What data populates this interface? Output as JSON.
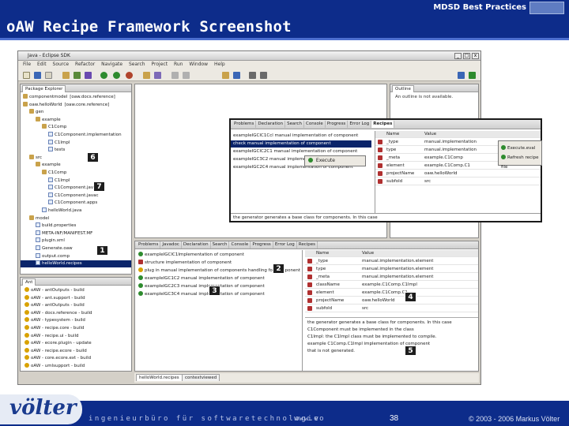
{
  "slide": {
    "subtitle": "MDSD Best Practices",
    "title": "oAW Recipe Framework Screenshot",
    "footer_tagline": "ingenieurbüro für softwaretechnologie",
    "footer_url": "www.vo",
    "page_number": "38",
    "copyright": "© 2003 - 2006 Markus Völter",
    "logo": "völter"
  },
  "ide": {
    "window_title": "Java - Eclipse SDK",
    "window_buttons": [
      "_",
      "□",
      "x"
    ],
    "menu": [
      "File",
      "Edit",
      "Source",
      "Refactor",
      "Navigate",
      "Search",
      "Project",
      "Run",
      "Window",
      "Help"
    ],
    "explorer": {
      "tab_label": "Package Explorer",
      "rows": [
        {
          "text": "componentmodel",
          "suffix": "[oaw.docs.reference]",
          "icon": "pkg",
          "depth": 0
        },
        {
          "text": "oaw.helloWorld",
          "suffix": "[oaw.core.reference]",
          "icon": "pkg",
          "depth": 0
        },
        {
          "text": "gen",
          "suffix": "",
          "icon": "pkg",
          "depth": 1
        },
        {
          "text": "example",
          "suffix": "",
          "icon": "pkg",
          "depth": 2
        },
        {
          "text": "C1Comp",
          "suffix": "",
          "icon": "pkg",
          "depth": 3
        },
        {
          "text": "C1Component.implementation",
          "suffix": "",
          "icon": "file",
          "depth": 4
        },
        {
          "text": "C1Impl",
          "suffix": "",
          "icon": "file",
          "depth": 4
        },
        {
          "text": "tests",
          "suffix": "",
          "icon": "file",
          "depth": 4
        },
        {
          "text": "src",
          "suffix": "",
          "icon": "pkg",
          "depth": 1
        },
        {
          "text": "example",
          "suffix": "",
          "icon": "pkg",
          "depth": 2
        },
        {
          "text": "C1Comp",
          "suffix": "",
          "icon": "pkg",
          "depth": 3
        },
        {
          "text": "C1Impl",
          "suffix": "",
          "icon": "file",
          "depth": 4
        },
        {
          "text": "C1Component.java",
          "suffix": "",
          "icon": "file",
          "depth": 4
        },
        {
          "text": "C1Component.javac",
          "suffix": "",
          "icon": "file",
          "depth": 4
        },
        {
          "text": "C1Component.apps",
          "suffix": "",
          "icon": "file",
          "depth": 4
        },
        {
          "text": "helloWorld.java",
          "suffix": "",
          "icon": "file",
          "depth": 3
        },
        {
          "text": "model",
          "suffix": "",
          "icon": "pkg",
          "depth": 1
        },
        {
          "text": "build.properties",
          "suffix": "",
          "icon": "file",
          "depth": 2
        },
        {
          "text": "META-INF/MANIFEST.MF",
          "suffix": "",
          "icon": "file",
          "depth": 2
        },
        {
          "text": "plugin.xml",
          "suffix": "",
          "icon": "file",
          "depth": 2
        },
        {
          "text": "Generate.oaw",
          "suffix": "",
          "icon": "file",
          "depth": 2
        },
        {
          "text": "output.comp",
          "suffix": "",
          "icon": "file",
          "depth": 2
        },
        {
          "text": "helloWorld.recipes",
          "suffix": "",
          "icon": "file",
          "depth": 2,
          "selected": true
        }
      ]
    },
    "ant": {
      "tab_label": "Ant",
      "rows": [
        "oAW - antOutputs - build",
        "oAW - ant.support - build",
        "oAW - antOutputs - build",
        "oAW - docs.reference - build",
        "oAW - typesystem - build",
        "oAW - recipe.core - build",
        "oAW - recipe.ui - build",
        "oAW - ecore.plugin - update",
        "oAW - recipe.ecore - build",
        "oAW - core.ecore.ext - build",
        "oAW - umlsupport - build"
      ]
    },
    "outline": {
      "tab_label": "Outline",
      "message": "An outline is not available."
    },
    "bottom_tabs": [
      "Problems",
      "Javadoc",
      "Declaration",
      "Search",
      "Console",
      "Progress",
      "Error Log",
      "Recipes"
    ],
    "checks": [
      {
        "text": "exampleIGCIC1Implementation of component",
        "state": "ok"
      },
      {
        "text": "structure implementation of component",
        "state": "error"
      },
      {
        "text": "plug in manual implementation of components handling for component",
        "state": "warn"
      },
      {
        "text": "exampleIGC1C2 manual implementation of component",
        "state": "ok"
      },
      {
        "text": "exampleIGC2C3 manual implementation of component",
        "state": "ok"
      },
      {
        "text": "exampleIGC3C4 manual implementation of component",
        "state": "ok"
      }
    ],
    "props": {
      "headers": [
        "Name",
        "Value"
      ],
      "rows": [
        [
          "_type",
          "manual.implementation.element"
        ],
        [
          "type",
          "manual.implementation.element"
        ],
        [
          "_meta",
          "manual.implementation.element"
        ],
        [
          "className",
          "example.C1Comp.C1Impl"
        ],
        [
          "element",
          "example.C1Comp.C1"
        ],
        [
          "projectName",
          "oaw.helloWorld"
        ],
        [
          "subfold",
          "src"
        ]
      ],
      "description": [
        "the generator generates a base class for components. In this case",
        "C1Component must be implemented in the class",
        "C1Impl: the C1Impl class must be implemented to compile.",
        "example C1Comp.C1Impl implementation of component",
        "that is not generated."
      ]
    },
    "editor_tabs": [
      "helloWorld.recipes",
      "contextviewed"
    ]
  },
  "zoom": {
    "tabs": [
      "Problems",
      "Declaration",
      "Search",
      "Console",
      "Progress",
      "Error Log",
      "Recipes"
    ],
    "rows": [
      {
        "text": "exampleIGCIC1Ccl manual implementation of component",
        "selected": false
      },
      {
        "text": "check manual implementation of component",
        "selected": true
      },
      {
        "text": "exampleIGCIC2C1 manual implementation of component",
        "selected": false
      },
      {
        "text": "exampleIGC3C2 manual implementation of component",
        "selected": false
      },
      {
        "text": "exampleIGC2C4 manual implementation of component",
        "selected": false
      }
    ],
    "context_menu": "Execute",
    "props_headers": [
      "Name",
      "Value"
    ],
    "props_rows": [
      [
        "_type",
        "manual.implementation"
      ],
      [
        "type",
        "manual.implementation"
      ],
      [
        "_meta",
        "example.C1Comp"
      ],
      [
        "element",
        "example.C1Comp.C1"
      ],
      [
        "projectName",
        "oaw.helloWorld"
      ],
      [
        "subfold",
        "src"
      ]
    ],
    "popup_items": [
      "Execute.eval",
      "Refresh recipe file"
    ],
    "status": "the generator generates a base class for components. In this case"
  },
  "callouts": [
    "1",
    "2",
    "3",
    "4",
    "5",
    "6",
    "7"
  ],
  "colors": {
    "header_blue": "#0d2c8a",
    "selection_blue": "#0a246a",
    "ok_green": "#2e8b2e",
    "error_red": "#b03030",
    "warning_yellow": "#d9a200"
  }
}
